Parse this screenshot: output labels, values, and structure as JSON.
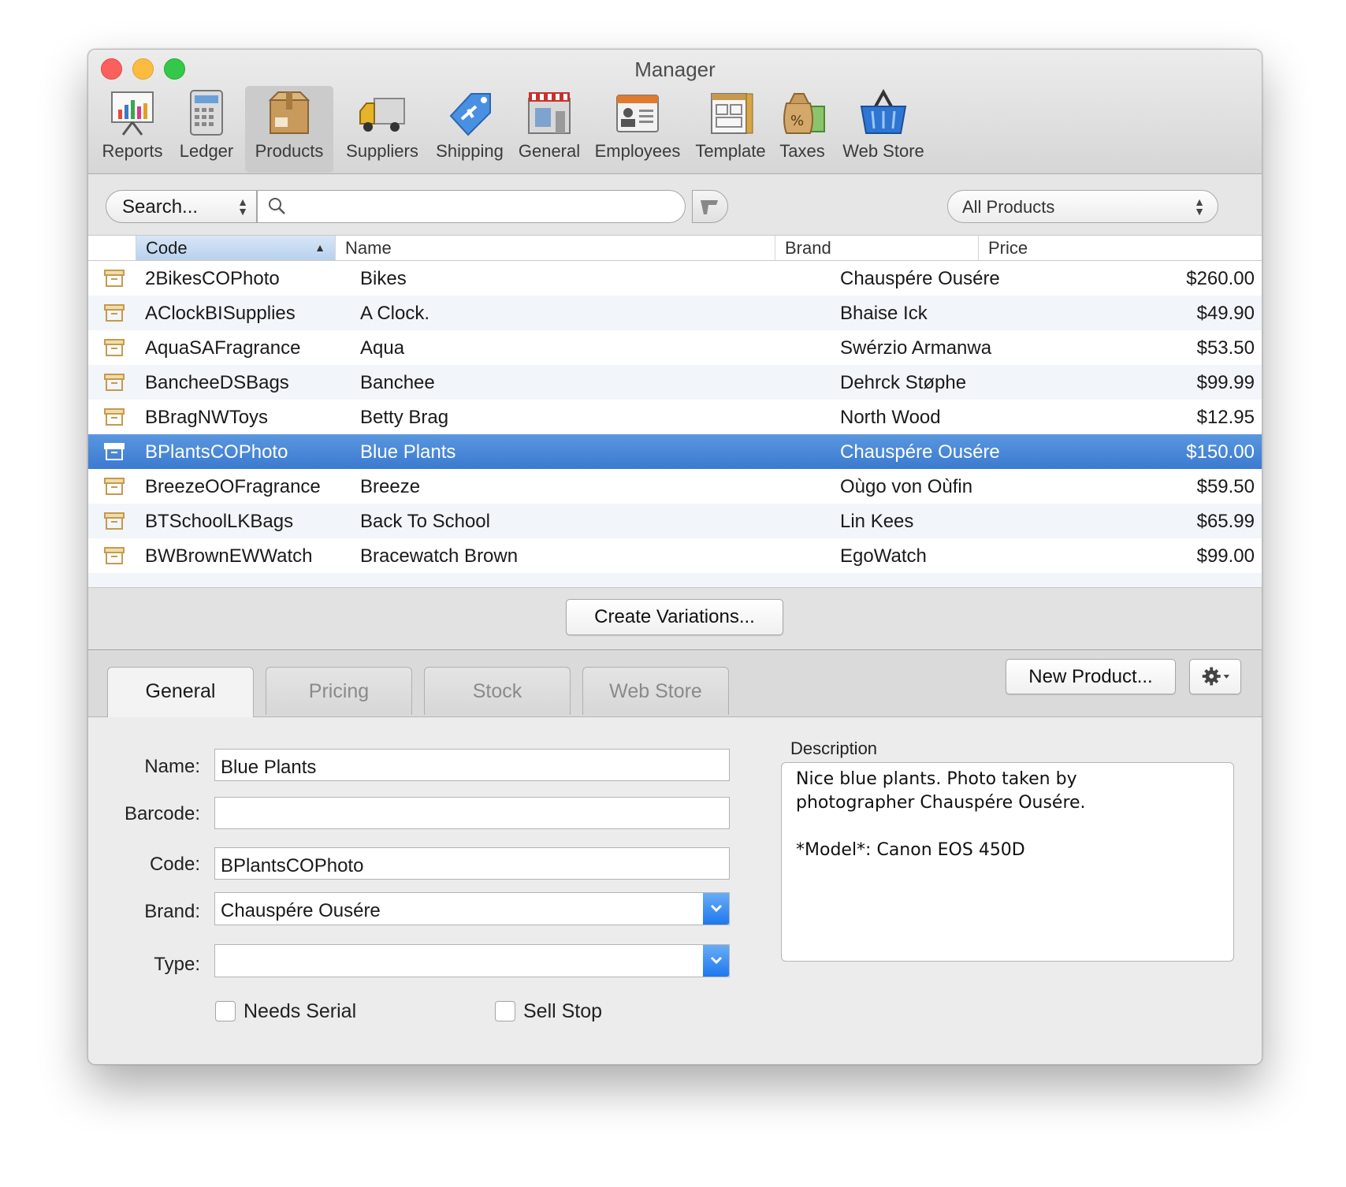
{
  "window": {
    "title": "Manager"
  },
  "toolbar": [
    {
      "label": "Reports",
      "icon": "reports-icon"
    },
    {
      "label": "Ledger",
      "icon": "ledger-icon"
    },
    {
      "label": "Products",
      "icon": "products-icon",
      "active": true
    },
    {
      "label": "Suppliers",
      "icon": "suppliers-icon"
    },
    {
      "label": "Shipping",
      "icon": "shipping-icon"
    },
    {
      "label": "General",
      "icon": "general-icon"
    },
    {
      "label": "Employees",
      "icon": "employees-icon"
    },
    {
      "label": "Template",
      "icon": "template-icon"
    },
    {
      "label": "Taxes",
      "icon": "taxes-icon"
    },
    {
      "label": "Web Store",
      "icon": "web-store-icon"
    }
  ],
  "search": {
    "scope_label": "Search...",
    "query": ""
  },
  "filter": {
    "selected": "All Products"
  },
  "table": {
    "columns": [
      "Code",
      "Name",
      "Brand",
      "Price"
    ],
    "sorted_column": "Code",
    "sort_direction": "ascending",
    "rows": [
      {
        "code": "2BikesCOPhoto",
        "name": "Bikes",
        "brand": "Chauspére Ousére",
        "price": "$260.00"
      },
      {
        "code": "AClockBISupplies",
        "name": "A Clock.",
        "brand": "Bhaise Ick",
        "price": "$49.90"
      },
      {
        "code": "AquaSAFragrance",
        "name": "Aqua",
        "brand": "Swérzio Armanwa",
        "price": "$53.50"
      },
      {
        "code": "BancheeDSBags",
        "name": "Banchee",
        "brand": "Dehrck Støphe",
        "price": "$99.99"
      },
      {
        "code": "BBragNWToys",
        "name": "Betty Brag",
        "brand": "North Wood",
        "price": "$12.95"
      },
      {
        "code": "BPlantsCOPhoto",
        "name": "Blue Plants",
        "brand": "Chauspére Ousére",
        "price": "$150.00",
        "selected": true
      },
      {
        "code": "BreezeOOFragrance",
        "name": "Breeze",
        "brand": "Oùgo von Oùfin",
        "price": "$59.50"
      },
      {
        "code": "BTSchoolLKBags",
        "name": "Back To School",
        "brand": "Lin Kees",
        "price": "$65.99"
      },
      {
        "code": "BWBrownEWWatch",
        "name": "Bracewatch Brown",
        "brand": "EgoWatch",
        "price": "$99.00"
      }
    ]
  },
  "actions": {
    "create_variations": "Create Variations...",
    "new_product": "New Product..."
  },
  "tabs": [
    "General",
    "Pricing",
    "Stock",
    "Web Store"
  ],
  "active_tab": "General",
  "form": {
    "name_label": "Name:",
    "name_value": "Blue Plants",
    "barcode_label": "Barcode:",
    "barcode_value": "",
    "code_label": "Code:",
    "code_value": "BPlantsCOPhoto",
    "brand_label": "Brand:",
    "brand_value": "Chauspére Ousére",
    "type_label": "Type:",
    "type_value": "",
    "needs_serial_label": "Needs Serial",
    "needs_serial_checked": false,
    "sell_stop_label": "Sell Stop",
    "sell_stop_checked": false,
    "description_label": "Description",
    "description_value": "Nice blue plants. Photo taken by\nphotographer Chauspére Ousére.\n\n*Model*: Canon EOS 450D"
  },
  "colors": {
    "selection": "#3f7fd4",
    "combo_button": "#2a82f0"
  }
}
